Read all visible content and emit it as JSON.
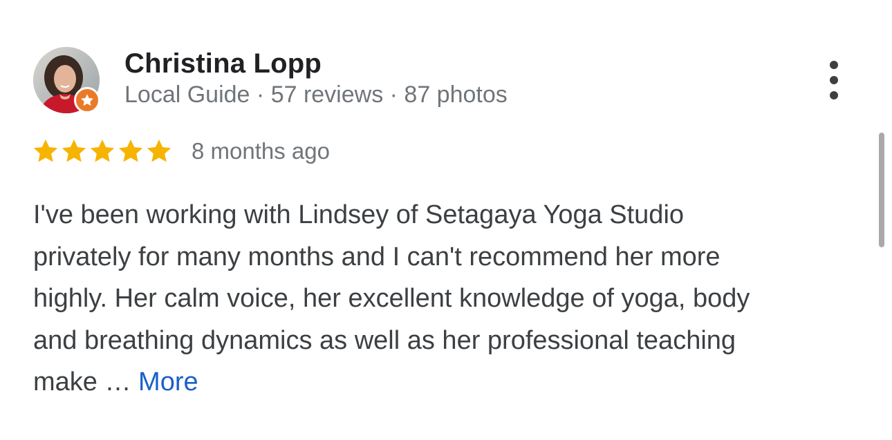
{
  "reviewer": {
    "name": "Christina Lopp",
    "badge_label": "Local Guide",
    "separator": " · ",
    "reviews": "57 reviews",
    "photos": "87 photos",
    "badge_icon": "star-icon",
    "badge_color": "#ea7a2a"
  },
  "menu": {
    "icon": "more-vertical-icon"
  },
  "rating": {
    "stars": 5,
    "max_stars": 5,
    "star_color": "#f6b400",
    "date": "8 months ago"
  },
  "review": {
    "lines": [
      "I've been working with Lindsey of Setagaya Yoga Studio",
      "privately for many months and I can't recommend her more",
      "highly. Her calm voice, her excellent knowledge of yoga, body",
      "and breathing dynamics as well as her professional teaching",
      "make … "
    ],
    "more_label": "More",
    "link_color": "#1a5fc9"
  }
}
